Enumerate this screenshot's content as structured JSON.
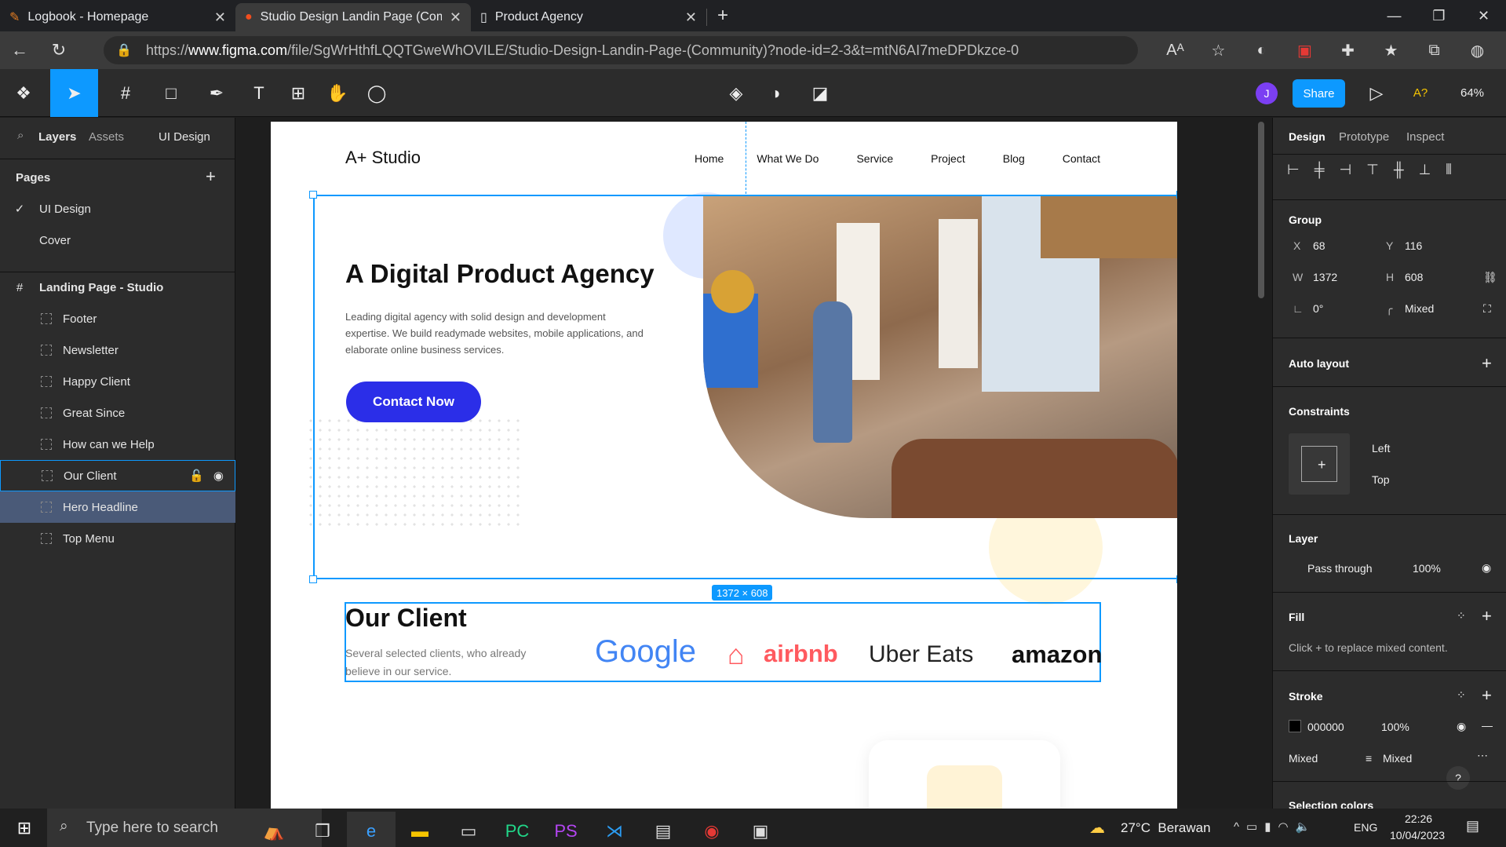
{
  "browser": {
    "tabs": [
      {
        "title": "Logbook - Homepage"
      },
      {
        "title": "Studio Design Landin Page (Com"
      },
      {
        "title": "Product Agency"
      }
    ],
    "url_prefix": "https://",
    "url_host": "www.figma.com",
    "url_path": "/file/SgWrHthfLQQTGweWhOVILE/Studio-Design-Landin-Page-(Community)?node-id=2-3&t=mtN6AI7meDPDkzce-0"
  },
  "toolbar": {
    "share": "Share",
    "avatar": "J",
    "zoom": "64%",
    "a_label": "A?"
  },
  "left_panel": {
    "tabs": [
      "Layers",
      "Assets"
    ],
    "page_selector": "UI Design",
    "pages_title": "Pages",
    "pages": [
      "UI Design",
      "Cover"
    ],
    "frame": "Landing Page - Studio",
    "layers": [
      "Footer",
      "Newsletter",
      "Happy Client",
      "Great Since",
      "How can we Help",
      "Our Client",
      "Hero Headline",
      "Top Menu"
    ]
  },
  "site": {
    "logo": "A+ Studio",
    "nav": [
      "Home",
      "What We Do",
      "Service",
      "Project",
      "Blog",
      "Contact"
    ],
    "hero_title": "A Digital Product Agency",
    "hero_text": "Leading digital agency with solid design and development expertise. We build readymade websites, mobile applications, and elaborate online business services.",
    "cta": "Contact Now",
    "size_badge": "1372 × 608",
    "client_title": "Our Client",
    "client_text": "Several selected clients, who already believe in our service.",
    "clients": [
      "Google",
      "airbnb",
      "Uber Eats",
      "amazon"
    ]
  },
  "right_panel": {
    "tabs": [
      "Design",
      "Prototype",
      "Inspect"
    ],
    "group_title": "Group",
    "x_label": "X",
    "x": "68",
    "y_label": "Y",
    "y": "116",
    "w_label": "W",
    "w": "1372",
    "h_label": "H",
    "h": "608",
    "rotation": "0°",
    "radius": "Mixed",
    "auto_layout": "Auto layout",
    "constraints": "Constraints",
    "c_h": "Left",
    "c_v": "Top",
    "layer_title": "Layer",
    "blend": "Pass through",
    "opacity": "100%",
    "fill_title": "Fill",
    "fill_text": "Click + to replace mixed content.",
    "stroke_title": "Stroke",
    "stroke_color": "000000",
    "stroke_opacity": "100%",
    "stroke_pos": "Mixed",
    "stroke_w": "Mixed",
    "selection_colors": "Selection colors"
  },
  "taskbar": {
    "search": "Type here to search",
    "weather": "27°C  Berawan",
    "lang": "ENG",
    "time": "22:26",
    "date": "10/04/2023"
  },
  "colors": {
    "accent": "#0d99ff",
    "cta": "#2b2ee8"
  }
}
